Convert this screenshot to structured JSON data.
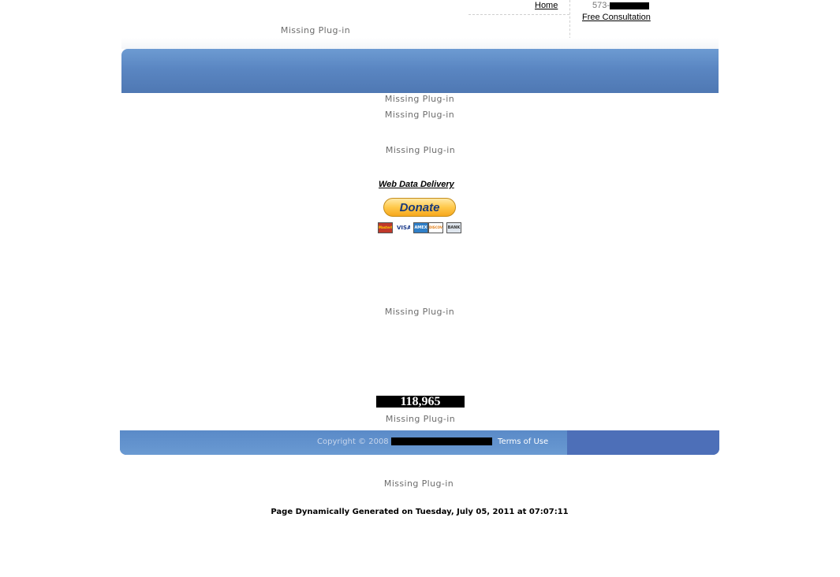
{
  "header": {
    "phone_prefix": "573-",
    "nav": {
      "home": "Home",
      "consultation": "Free Consultation"
    },
    "plugin_text": "Missing Plug-in"
  },
  "main": {
    "plugins": [
      "Missing Plug-in",
      "Missing Plug-in",
      "Missing Plug-in",
      "Missing Plug-in",
      "Missing Plug-in"
    ],
    "web_data_link": "Web Data Delivery",
    "donate_label": "Donate",
    "payment_cards": [
      {
        "label": "MasterCard",
        "icon": "mastercard-icon",
        "bg": "#c0392b",
        "fg": "#ffd200"
      },
      {
        "label": "VISA",
        "icon": "visa-icon",
        "bg": "#ffffff",
        "fg": "#1a3a8a"
      },
      {
        "label": "AMEX",
        "icon": "amex-icon",
        "bg": "#2f7fc8",
        "fg": "#ffffff"
      },
      {
        "label": "DISCOVER",
        "icon": "discover-icon",
        "bg": "#ffffff",
        "fg": "#e07a10"
      },
      {
        "label": "BANK",
        "icon": "bank-icon",
        "bg": "#dfe6ee",
        "fg": "#333333"
      }
    ],
    "counter": "118,965"
  },
  "footer": {
    "copyright": "Copyright © 2008",
    "terms": "Terms of Use",
    "plugin_text": "Missing Plug-in",
    "generated": "Page Dynamically Generated on Tuesday, July 05, 2011 at 07:07:11"
  },
  "colors": {
    "header_band": "#5a86c2",
    "footer_band": "#5a86c4",
    "footer_right": "#4d6fb8",
    "donate": "#ffc84a"
  }
}
